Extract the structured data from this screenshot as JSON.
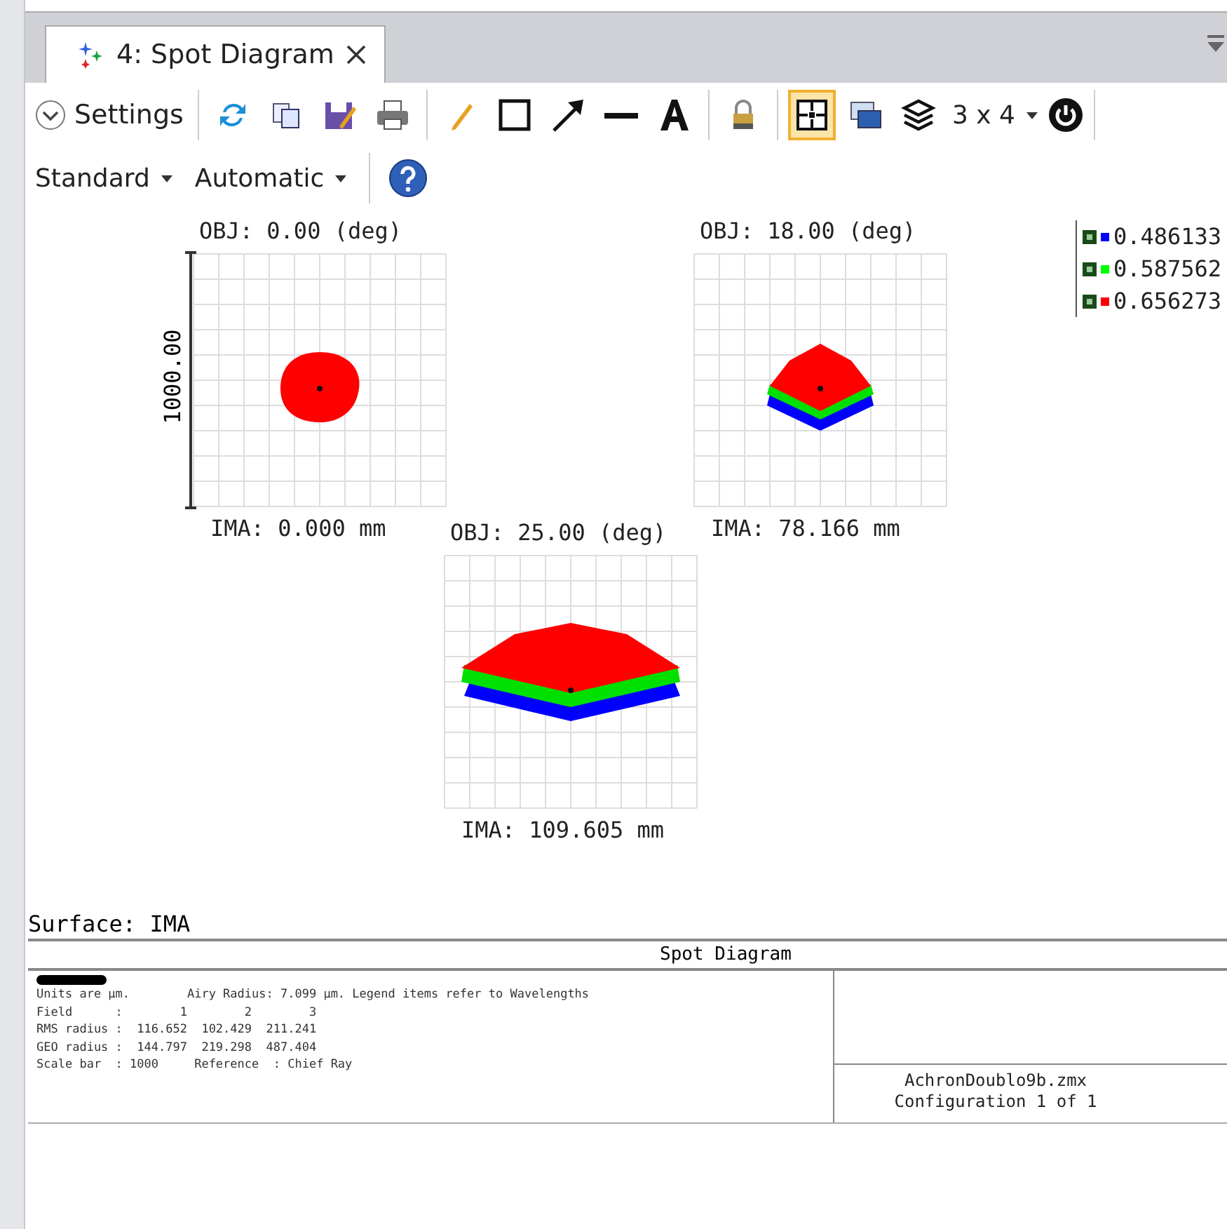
{
  "tab": {
    "label": "4: Spot Diagram",
    "selected": true
  },
  "toolbar": {
    "settings": "Settings",
    "tools": [
      {
        "kind": "refresh",
        "selected": false
      },
      {
        "kind": "copy",
        "selected": false
      },
      {
        "kind": "save",
        "selected": false
      },
      {
        "kind": "print",
        "selected": false
      },
      {
        "kind": "sep"
      },
      {
        "kind": "pencil",
        "selected": false
      },
      {
        "kind": "rect",
        "selected": false
      },
      {
        "kind": "arrow",
        "selected": false
      },
      {
        "kind": "line",
        "selected": false
      },
      {
        "kind": "text",
        "selected": false
      },
      {
        "kind": "sep"
      },
      {
        "kind": "lock",
        "selected": false
      },
      {
        "kind": "sep"
      },
      {
        "kind": "grid",
        "selected": true
      },
      {
        "kind": "windows",
        "selected": false
      },
      {
        "kind": "layers",
        "selected": false
      }
    ],
    "layout": "3 x 4",
    "row2": [
      "Standard",
      "Automatic"
    ]
  },
  "legend": [
    {
      "label": "0.486133",
      "color": "#0000ff"
    },
    {
      "label": "0.587562",
      "color": "#00ff00"
    },
    {
      "label": "0.656273",
      "color": "#ff0000"
    }
  ],
  "plots": [
    {
      "title": "OBJ: 0.00 (deg)",
      "footer": "IMA: 0.000 mm",
      "kind": "round",
      "scale": "1000.00"
    },
    {
      "title": "OBJ: 18.00 (deg)",
      "footer": "IMA: 78.166 mm",
      "kind": "small"
    },
    {
      "title": "OBJ: 25.00 (deg)",
      "footer": "IMA: 109.605 mm",
      "kind": "large"
    }
  ],
  "surface": "Surface: IMA",
  "report": {
    "title": "Spot Diagram",
    "lines": [
      "Units are µm.        Airy Radius: 7.099 µm. Legend items refer to Wavelengths",
      "Field      :        1        2        3",
      "RMS radius :  116.652  102.429  211.241",
      "GEO radius :  144.797  219.298  487.404",
      "Scale bar  : 1000     Reference  : Chief Ray"
    ],
    "file": "AchronDoublo9b.zmx",
    "config": "Configuration 1 of 1"
  }
}
